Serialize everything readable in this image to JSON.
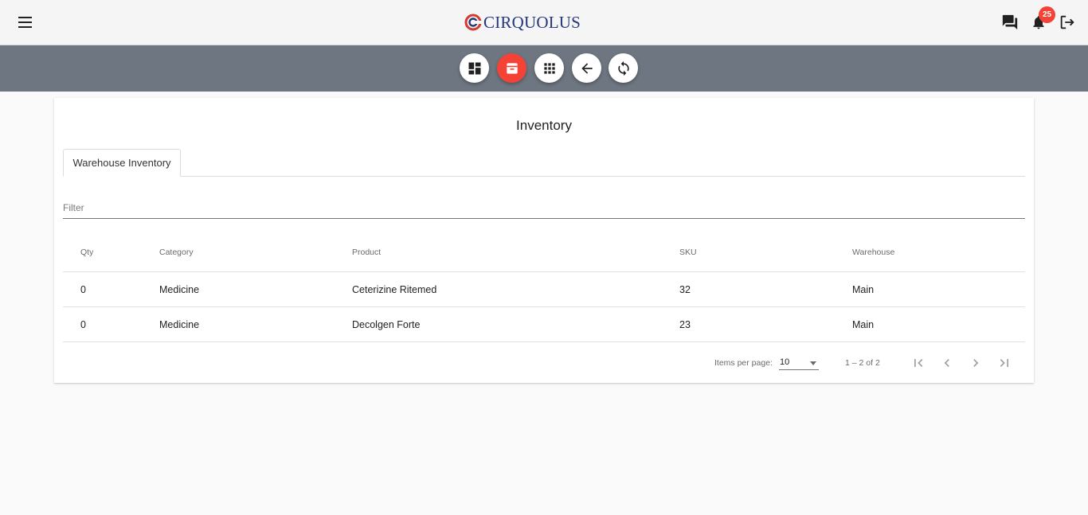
{
  "header": {
    "logo_text": "CIRQUOLUS",
    "notification_count": "25",
    "menu_icon": "menu-icon",
    "chat_icon": "chat-icon",
    "bell_icon": "bell-icon",
    "logout_icon": "logout-icon"
  },
  "toolbar": {
    "buttons": [
      {
        "icon": "dashboard-icon",
        "active": false
      },
      {
        "icon": "archive-icon",
        "active": true
      },
      {
        "icon": "apps-grid-icon",
        "active": false
      },
      {
        "icon": "arrow-back-icon",
        "active": false
      },
      {
        "icon": "refresh-icon",
        "active": false
      }
    ],
    "active_color": "#f44336",
    "bar_color": "#6e7681"
  },
  "main": {
    "title": "Inventory",
    "tabs": [
      {
        "label": "Warehouse Inventory"
      }
    ],
    "filter": {
      "placeholder": "Filter",
      "value": ""
    },
    "table": {
      "columns": [
        "Qty",
        "Category",
        "Product",
        "SKU",
        "Warehouse"
      ],
      "rows": [
        [
          "0",
          "Medicine",
          "Ceterizine Ritemed",
          "32",
          "Main"
        ],
        [
          "0",
          "Medicine",
          "Decolgen Forte",
          "23",
          "Main"
        ]
      ]
    },
    "paginator": {
      "items_per_page_label": "Items per page:",
      "items_per_page_value": "10",
      "range_label": "1 – 2 of 2"
    }
  }
}
